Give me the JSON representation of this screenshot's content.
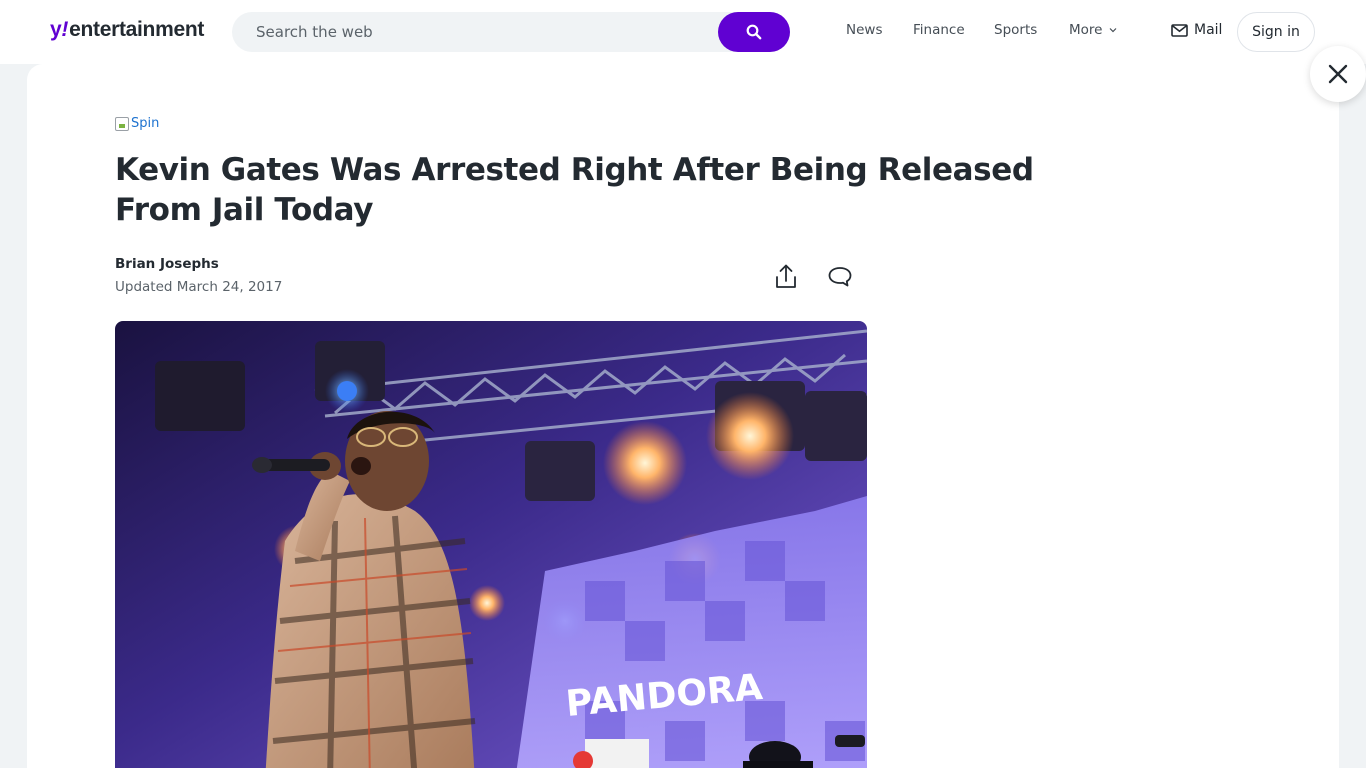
{
  "header": {
    "logo": {
      "y": "y",
      "bang": "!",
      "word": "entertainment"
    },
    "search": {
      "placeholder": "Search the web"
    },
    "nav": {
      "news": "News",
      "finance": "Finance",
      "sports": "Sports",
      "more": "More"
    },
    "mail": "Mail",
    "sign_in": "Sign in"
  },
  "article": {
    "source_alt": "Spin",
    "headline": "Kevin Gates Was Arrested Right After Being Released From Jail Today",
    "author": "Brian Josephs",
    "updated": "Updated March 24, 2017",
    "hero_image": {
      "stage_sign": "PANDORA",
      "icons": [
        "microphone",
        "stage-lights",
        "truss"
      ]
    }
  },
  "colors": {
    "brand": "#6001d2",
    "text": "#232a31",
    "muted": "#5b636a",
    "page_bg": "#f0f3f5"
  }
}
